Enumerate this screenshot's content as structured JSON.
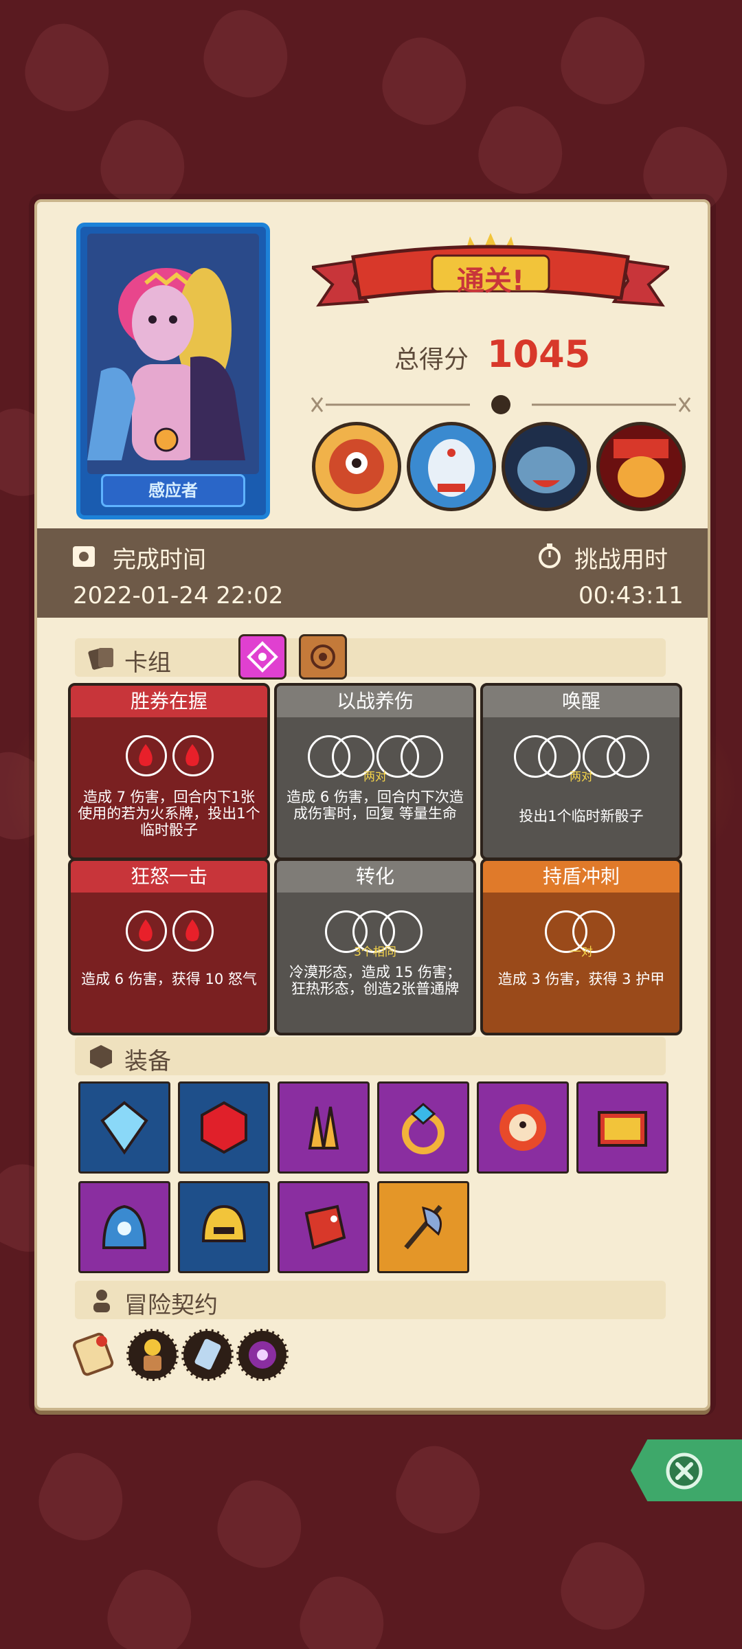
{
  "hero": {
    "name": "感应者"
  },
  "result": {
    "banner": "通关!",
    "score_label": "总得分",
    "score": "1045"
  },
  "bosses": [
    {
      "icon": "boss-cyclops-icon"
    },
    {
      "icon": "boss-masked-icon"
    },
    {
      "icon": "boss-shark-icon"
    },
    {
      "icon": "boss-jester-icon"
    }
  ],
  "time": {
    "complete_label": "完成时间",
    "complete_value": "2022-01-24 22:02",
    "challenge_label": "挑战用时",
    "challenge_value": "00:43:11"
  },
  "deck": {
    "title": "卡组",
    "cards": [
      {
        "title": "胜券在握",
        "sub": "",
        "desc": "造成 7 伤害，回合内下1张使用的若为火系牌，投出1个临时骰子",
        "color": "red"
      },
      {
        "title": "以战养伤",
        "sub": "两对",
        "desc": "造成 6 伤害，回合内下次造成伤害时，回复 等量生命",
        "color": "gray"
      },
      {
        "title": "唤醒",
        "sub": "两对",
        "desc": "投出1个临时新骰子",
        "color": "gray"
      },
      {
        "title": "狂怒一击",
        "sub": "",
        "desc": "造成 6 伤害，获得 10 怒气",
        "color": "red"
      },
      {
        "title": "转化",
        "sub": "3个相同",
        "desc": "冷漠形态，造成 15 伤害；狂热形态，创造2张普通牌",
        "color": "gray"
      },
      {
        "title": "持盾冲刺",
        "sub": "一对",
        "desc": "造成 3 伤害，获得 3 护甲",
        "color": "orange"
      }
    ]
  },
  "equipment": {
    "title": "装备",
    "items": [
      {
        "icon": "diamond-gem-icon",
        "color": "#1e4f8a"
      },
      {
        "icon": "ruby-gem-icon",
        "color": "#1e4f8a"
      },
      {
        "icon": "claw-gauntlet-icon",
        "color": "#8a2ea0"
      },
      {
        "icon": "sapphire-ring-icon",
        "color": "#8a2ea0"
      },
      {
        "icon": "sun-mask-icon",
        "color": "#8a2ea0"
      },
      {
        "icon": "spell-book-icon",
        "color": "#8a2ea0"
      },
      {
        "icon": "demon-helm-icon",
        "color": "#8a2ea0"
      },
      {
        "icon": "golden-helmet-icon",
        "color": "#1e4f8a"
      },
      {
        "icon": "dragon-bracer-icon",
        "color": "#8a2ea0"
      },
      {
        "icon": "battle-axe-icon",
        "color": "#e49628"
      }
    ]
  },
  "contract": {
    "title": "冒险契约",
    "tokens": [
      {
        "icon": "scroll-icon"
      },
      {
        "icon": "flower-pot-icon"
      },
      {
        "icon": "tag-icon"
      },
      {
        "icon": "purple-eye-icon"
      }
    ]
  }
}
